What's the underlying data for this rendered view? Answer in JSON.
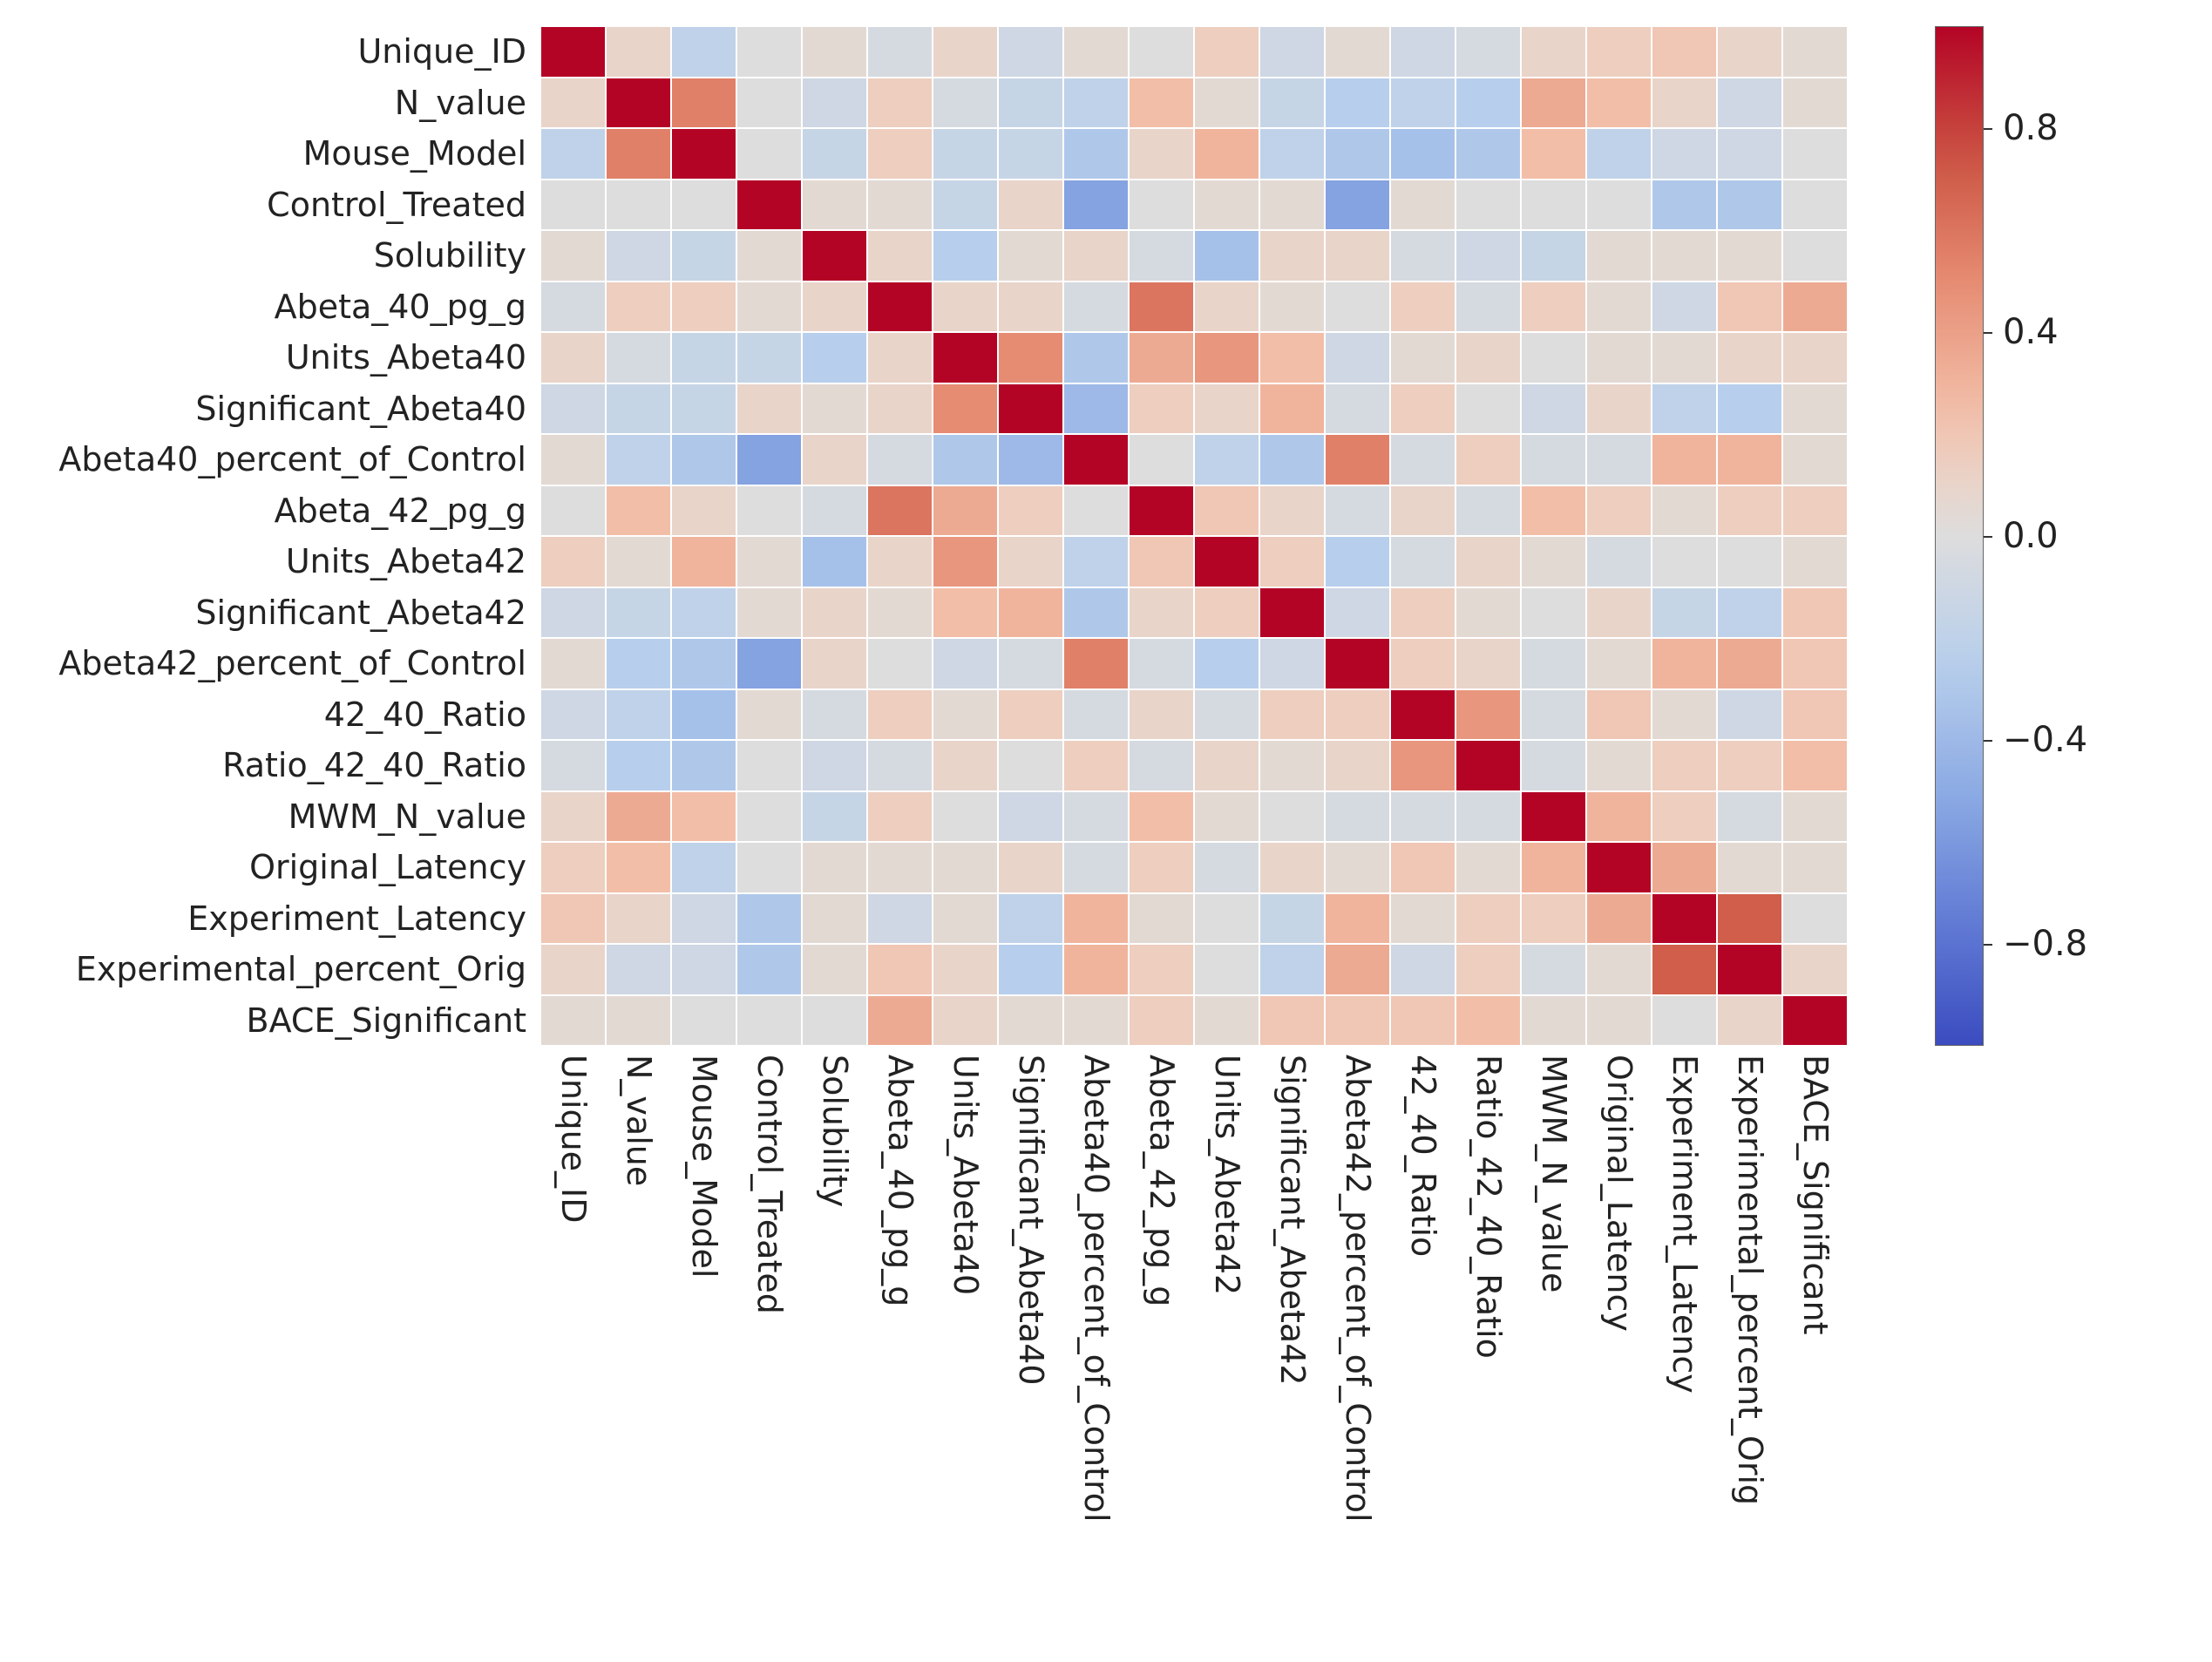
{
  "chart_data": {
    "type": "heatmap",
    "title": "",
    "xlabel": "",
    "ylabel": "",
    "labels": [
      "Unique_ID",
      "N_value",
      "Mouse_Model",
      "Control_Treated",
      "Solubility",
      "Abeta_40_pg_g",
      "Units_Abeta40",
      "Significant_Abeta40",
      "Abeta40_percent_of_Control",
      "Abeta_42_pg_g",
      "Units_Abeta42",
      "Significant_Abeta42",
      "Abeta42_percent_of_Control",
      "42_40_Ratio",
      "Ratio_42_40_Ratio",
      "MWM_N_value",
      "Original_Latency",
      "Experiment_Latency",
      "Experimental_percent_Orig",
      "BACE_Significant"
    ],
    "matrix": [
      [
        1.0,
        0.1,
        -0.2,
        0.0,
        0.05,
        -0.05,
        0.1,
        -0.1,
        0.05,
        0.0,
        0.15,
        -0.1,
        0.05,
        -0.1,
        -0.05,
        0.1,
        0.15,
        0.2,
        0.1,
        0.05
      ],
      [
        0.1,
        1.0,
        0.55,
        0.0,
        -0.1,
        0.15,
        -0.05,
        -0.15,
        -0.2,
        0.25,
        0.05,
        -0.15,
        -0.25,
        -0.2,
        -0.25,
        0.35,
        0.25,
        0.1,
        -0.1,
        0.05
      ],
      [
        -0.2,
        0.55,
        1.0,
        0.0,
        -0.15,
        0.15,
        -0.15,
        -0.15,
        -0.3,
        0.1,
        0.3,
        -0.2,
        -0.3,
        -0.35,
        -0.3,
        0.25,
        -0.2,
        -0.1,
        -0.1,
        0.0
      ],
      [
        0.0,
        0.0,
        0.0,
        1.0,
        0.05,
        0.05,
        -0.15,
        0.1,
        -0.55,
        0.0,
        0.05,
        0.05,
        -0.55,
        0.05,
        0.0,
        0.0,
        0.0,
        -0.3,
        -0.3,
        0.0
      ],
      [
        0.05,
        -0.1,
        -0.15,
        0.05,
        1.0,
        0.1,
        -0.25,
        0.05,
        0.1,
        -0.05,
        -0.35,
        0.1,
        0.1,
        -0.05,
        -0.1,
        -0.15,
        0.05,
        0.05,
        0.05,
        0.0
      ],
      [
        -0.05,
        0.15,
        0.15,
        0.05,
        0.1,
        1.0,
        0.1,
        0.1,
        -0.05,
        0.6,
        0.1,
        0.05,
        0.0,
        0.15,
        -0.05,
        0.15,
        0.05,
        -0.1,
        0.2,
        0.35
      ],
      [
        0.1,
        -0.05,
        -0.15,
        -0.15,
        -0.25,
        0.1,
        1.0,
        0.5,
        -0.3,
        0.35,
        0.45,
        0.25,
        -0.1,
        0.05,
        0.1,
        0.0,
        0.05,
        0.05,
        0.1,
        0.1
      ],
      [
        -0.1,
        -0.15,
        -0.15,
        0.1,
        0.05,
        0.1,
        0.5,
        1.0,
        -0.4,
        0.15,
        0.1,
        0.3,
        -0.05,
        0.15,
        0.0,
        -0.1,
        0.1,
        -0.2,
        -0.25,
        0.05
      ],
      [
        0.05,
        -0.2,
        -0.3,
        -0.55,
        0.1,
        -0.05,
        -0.3,
        -0.4,
        1.0,
        0.0,
        -0.2,
        -0.3,
        0.55,
        -0.05,
        0.15,
        -0.05,
        -0.05,
        0.3,
        0.3,
        0.05
      ],
      [
        0.0,
        0.25,
        0.1,
        0.0,
        -0.05,
        0.6,
        0.35,
        0.15,
        0.0,
        1.0,
        0.2,
        0.1,
        -0.05,
        0.1,
        -0.05,
        0.25,
        0.15,
        0.05,
        0.15,
        0.15
      ],
      [
        0.15,
        0.05,
        0.3,
        0.05,
        -0.35,
        0.1,
        0.45,
        0.1,
        -0.2,
        0.2,
        1.0,
        0.15,
        -0.25,
        -0.05,
        0.1,
        0.05,
        -0.05,
        0.0,
        0.0,
        0.05
      ],
      [
        -0.1,
        -0.15,
        -0.2,
        0.05,
        0.1,
        0.05,
        0.25,
        0.3,
        -0.3,
        0.1,
        0.15,
        1.0,
        -0.1,
        0.15,
        0.05,
        0.0,
        0.1,
        -0.15,
        -0.2,
        0.2
      ],
      [
        0.05,
        -0.25,
        -0.3,
        -0.55,
        0.1,
        0.0,
        -0.1,
        -0.05,
        0.55,
        -0.05,
        -0.25,
        -0.1,
        1.0,
        0.15,
        0.1,
        -0.05,
        0.05,
        0.3,
        0.35,
        0.2
      ],
      [
        -0.1,
        -0.2,
        -0.35,
        0.05,
        -0.05,
        0.15,
        0.05,
        0.15,
        -0.05,
        0.1,
        -0.05,
        0.15,
        0.15,
        1.0,
        0.45,
        -0.05,
        0.2,
        0.05,
        -0.1,
        0.2
      ],
      [
        -0.05,
        -0.25,
        -0.3,
        0.0,
        -0.1,
        -0.05,
        0.1,
        0.0,
        0.15,
        -0.05,
        0.1,
        0.05,
        0.1,
        0.45,
        1.0,
        -0.05,
        0.05,
        0.15,
        0.15,
        0.25
      ],
      [
        0.1,
        0.35,
        0.25,
        0.0,
        -0.15,
        0.15,
        0.0,
        -0.1,
        -0.05,
        0.25,
        0.05,
        0.0,
        -0.05,
        -0.05,
        -0.05,
        1.0,
        0.3,
        0.15,
        -0.05,
        0.05
      ],
      [
        0.15,
        0.25,
        -0.2,
        0.0,
        0.05,
        0.05,
        0.05,
        0.1,
        -0.05,
        0.15,
        -0.05,
        0.1,
        0.05,
        0.2,
        0.05,
        0.3,
        1.0,
        0.35,
        0.05,
        0.05
      ],
      [
        0.2,
        0.1,
        -0.1,
        -0.3,
        0.05,
        -0.1,
        0.05,
        -0.2,
        0.3,
        0.05,
        0.0,
        -0.15,
        0.3,
        0.05,
        0.15,
        0.15,
        0.35,
        1.0,
        0.7,
        0.0
      ],
      [
        0.1,
        -0.1,
        -0.1,
        -0.3,
        0.05,
        0.2,
        0.1,
        -0.25,
        0.3,
        0.15,
        0.0,
        -0.2,
        0.35,
        -0.1,
        0.15,
        -0.05,
        0.05,
        0.7,
        1.0,
        0.1
      ],
      [
        0.05,
        0.05,
        0.0,
        0.0,
        0.0,
        0.35,
        0.1,
        0.05,
        0.05,
        0.15,
        0.05,
        0.2,
        0.2,
        0.2,
        0.25,
        0.05,
        0.05,
        0.0,
        0.1,
        1.0
      ]
    ],
    "colorbar": {
      "vmin": -1.0,
      "vmax": 1.0,
      "ticks": [
        -0.8,
        -0.4,
        0.0,
        0.4,
        0.8
      ],
      "tick_labels": [
        "−0.8",
        "−0.4",
        "0.0",
        "0.4",
        "0.8"
      ]
    },
    "cmap": "coolwarm"
  }
}
